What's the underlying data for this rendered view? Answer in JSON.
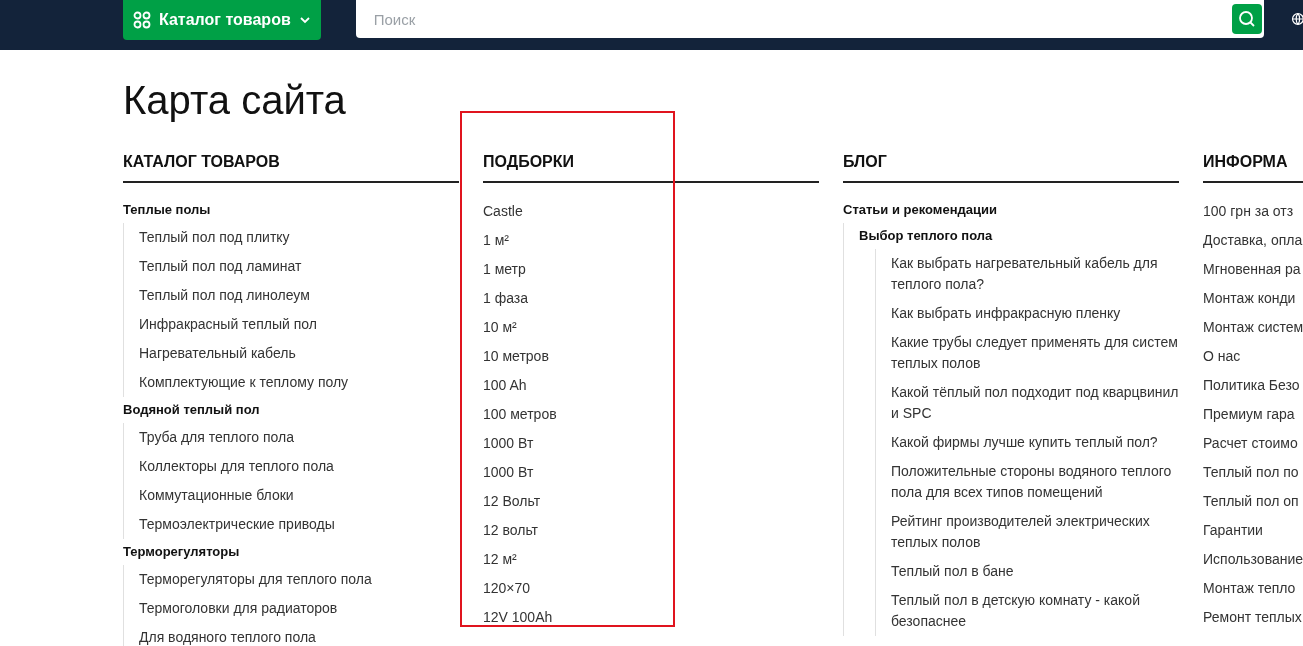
{
  "header": {
    "catalog_button": "Каталог товаров",
    "search": {
      "placeholder": "Поиск"
    }
  },
  "page_title": "Карта сайта",
  "columns": [
    {
      "title": "КАТАЛОГ ТОВАРОВ",
      "highlighted": false,
      "items": [
        {
          "kind": "group",
          "text": "Теплые полы",
          "children": [
            {
              "kind": "link",
              "text": "Теплый пол под плитку"
            },
            {
              "kind": "link",
              "text": "Теплый пол под ламинат"
            },
            {
              "kind": "link",
              "text": "Теплый пол под линолеум"
            },
            {
              "kind": "link",
              "text": "Инфракрасный теплый пол"
            },
            {
              "kind": "link",
              "text": "Нагревательный кабель"
            },
            {
              "kind": "link",
              "text": "Комплектующие к теплому полу"
            }
          ]
        },
        {
          "kind": "group",
          "text": "Водяной теплый пол",
          "children": [
            {
              "kind": "link",
              "text": "Труба для теплого пола"
            },
            {
              "kind": "link",
              "text": "Коллекторы для теплого пола"
            },
            {
              "kind": "link",
              "text": "Коммутационные блоки"
            },
            {
              "kind": "link",
              "text": "Термоэлектрические приводы"
            }
          ]
        },
        {
          "kind": "group",
          "text": "Терморегуляторы",
          "children": [
            {
              "kind": "link",
              "text": "Терморегуляторы для теплого пола"
            },
            {
              "kind": "link",
              "text": "Термоголовки для радиаторов"
            },
            {
              "kind": "link",
              "text": "Для водяного теплого пола"
            }
          ]
        }
      ]
    },
    {
      "title": "ПОДБОРКИ",
      "highlighted": true,
      "items": [
        {
          "kind": "link",
          "text": "Castle"
        },
        {
          "kind": "link",
          "text": "1 м²"
        },
        {
          "kind": "link",
          "text": "1 метр"
        },
        {
          "kind": "link",
          "text": "1 фаза"
        },
        {
          "kind": "link",
          "text": "10 м²"
        },
        {
          "kind": "link",
          "text": "10 метров"
        },
        {
          "kind": "link",
          "text": "100 Ah"
        },
        {
          "kind": "link",
          "text": "100 метров"
        },
        {
          "kind": "link",
          "text": "1000 Вт"
        },
        {
          "kind": "link",
          "text": "1000 Вт"
        },
        {
          "kind": "link",
          "text": "12 Вольт"
        },
        {
          "kind": "link",
          "text": "12 вольт"
        },
        {
          "kind": "link",
          "text": "12 м²"
        },
        {
          "kind": "link",
          "text": "120×70"
        },
        {
          "kind": "link",
          "text": "12V 100Ah"
        }
      ]
    },
    {
      "title": "БЛОГ",
      "highlighted": false,
      "items": [
        {
          "kind": "group",
          "text": "Статьи и рекомендации",
          "children": [
            {
              "kind": "group",
              "text": "Выбор теплого пола",
              "children": [
                {
                  "kind": "link",
                  "text": "Как выбрать нагревательный кабель для теплого пола?"
                },
                {
                  "kind": "link",
                  "text": "Как выбрать инфракрасную пленку"
                },
                {
                  "kind": "link",
                  "text": "Какие трубы следует применять для систем теплых полов"
                },
                {
                  "kind": "link",
                  "text": "Какой тёплый пол подходит под кварцвинил и SPC"
                },
                {
                  "kind": "link",
                  "text": "Какой фирмы лучше купить теплый пол?"
                },
                {
                  "kind": "link",
                  "text": "Положительные стороны водяного теплого пола для всех типов помещений"
                },
                {
                  "kind": "link",
                  "text": "Рейтинг производителей электрических теплых полов"
                },
                {
                  "kind": "link",
                  "text": "Теплый пол в бане"
                },
                {
                  "kind": "link",
                  "text": "Теплый пол в детскую комнату - какой безопаснее"
                }
              ]
            }
          ]
        }
      ]
    },
    {
      "title": "ИНФОРМА",
      "highlighted": false,
      "items": [
        {
          "kind": "link",
          "text": "100 грн за отз"
        },
        {
          "kind": "link",
          "text": "Доставка, опла"
        },
        {
          "kind": "link",
          "text": "Мгновенная ра"
        },
        {
          "kind": "link",
          "text": "Монтаж конди"
        },
        {
          "kind": "link",
          "text": "Монтаж систем"
        },
        {
          "kind": "link",
          "text": "О нас"
        },
        {
          "kind": "link",
          "text": "Политика Безо"
        },
        {
          "kind": "link",
          "text": "Премиум гара"
        },
        {
          "kind": "link",
          "text": "Расчет стоимо"
        },
        {
          "kind": "link",
          "text": "Теплый пол по"
        },
        {
          "kind": "link",
          "text": "Теплый пол оп"
        },
        {
          "kind": "link",
          "text": "Гарантии"
        },
        {
          "kind": "link",
          "text": "Использование"
        },
        {
          "kind": "link",
          "text": "Монтаж тепло"
        },
        {
          "kind": "link",
          "text": "Ремонт теплых"
        }
      ]
    }
  ]
}
